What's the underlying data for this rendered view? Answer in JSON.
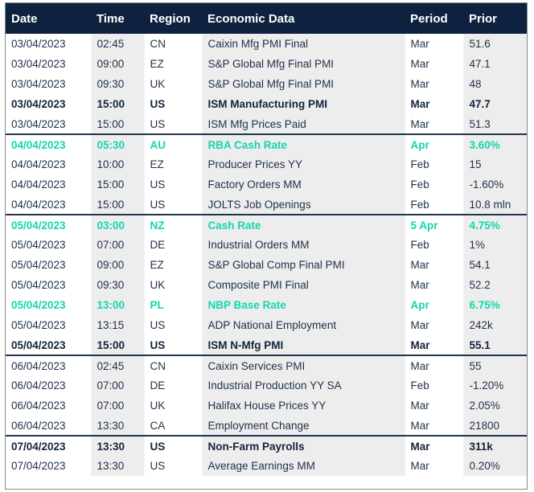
{
  "table": {
    "columns": [
      {
        "key": "date",
        "label": "Date"
      },
      {
        "key": "time",
        "label": "Time"
      },
      {
        "key": "region",
        "label": "Region"
      },
      {
        "key": "data",
        "label": "Economic Data"
      },
      {
        "key": "period",
        "label": "Period"
      },
      {
        "key": "prior",
        "label": "Prior"
      }
    ],
    "colors": {
      "header_bg": "#0e2240",
      "header_text": "#ffffff",
      "body_text": "#1f3048",
      "accent": "#13d6ae",
      "bold_text": "#12243c",
      "shade_bg": "#ededed",
      "row_bg": "#ffffff",
      "group_rule": "#20344d",
      "outer_border": "#8a8a8a"
    },
    "rows": [
      {
        "date": "03/04/2023",
        "time": "02:45",
        "region": "CN",
        "data": "Caixin Mfg PMI Final",
        "period": "Mar",
        "prior": "51.6",
        "style": "normal",
        "group_start": true
      },
      {
        "date": "03/04/2023",
        "time": "09:00",
        "region": "EZ",
        "data": "S&P Global Mfg Final PMI",
        "period": "Mar",
        "prior": "47.1",
        "style": "normal",
        "group_start": false
      },
      {
        "date": "03/04/2023",
        "time": "09:30",
        "region": "UK",
        "data": "S&P Global Mfg Final PMI",
        "period": "Mar",
        "prior": "48",
        "style": "normal",
        "group_start": false
      },
      {
        "date": "03/04/2023",
        "time": "15:00",
        "region": "US",
        "data": "ISM Manufacturing PMI",
        "period": "Mar",
        "prior": "47.7",
        "style": "bold",
        "group_start": false
      },
      {
        "date": "03/04/2023",
        "time": "15:00",
        "region": "US",
        "data": "ISM Mfg Prices Paid",
        "period": "Mar",
        "prior": "51.3",
        "style": "normal",
        "group_start": false
      },
      {
        "date": "04/04/2023",
        "time": "05:30",
        "region": "AU",
        "data": "RBA Cash Rate",
        "period": "Apr",
        "prior": "3.60%",
        "style": "accent",
        "group_start": true
      },
      {
        "date": "04/04/2023",
        "time": "10:00",
        "region": "EZ",
        "data": "Producer Prices YY",
        "period": "Feb",
        "prior": "15",
        "style": "normal",
        "group_start": false
      },
      {
        "date": "04/04/2023",
        "time": "15:00",
        "region": "US",
        "data": "Factory Orders MM",
        "period": "Feb",
        "prior": "-1.60%",
        "style": "normal",
        "group_start": false
      },
      {
        "date": "04/04/2023",
        "time": "15:00",
        "region": "US",
        "data": "JOLTS Job Openings",
        "period": "Feb",
        "prior": "10.8 mln",
        "style": "normal",
        "group_start": false
      },
      {
        "date": "05/04/2023",
        "time": "03:00",
        "region": "NZ",
        "data": "Cash Rate",
        "period": "5 Apr",
        "prior": "4.75%",
        "style": "accent",
        "group_start": true
      },
      {
        "date": "05/04/2023",
        "time": "07:00",
        "region": "DE",
        "data": "Industrial Orders MM",
        "period": "Feb",
        "prior": "1%",
        "style": "normal",
        "group_start": false
      },
      {
        "date": "05/04/2023",
        "time": "09:00",
        "region": "EZ",
        "data": "S&P Global Comp Final PMI",
        "period": "Mar",
        "prior": "54.1",
        "style": "normal",
        "group_start": false
      },
      {
        "date": "05/04/2023",
        "time": "09:30",
        "region": "UK",
        "data": "Composite PMI Final",
        "period": "Mar",
        "prior": "52.2",
        "style": "normal",
        "group_start": false
      },
      {
        "date": "05/04/2023",
        "time": "13:00",
        "region": "PL",
        "data": "NBP Base Rate",
        "period": "Apr",
        "prior": "6.75%",
        "style": "accent",
        "group_start": false
      },
      {
        "date": "05/04/2023",
        "time": "13:15",
        "region": "US",
        "data": "ADP National Employment",
        "period": "Mar",
        "prior": "242k",
        "style": "normal",
        "group_start": false
      },
      {
        "date": "05/04/2023",
        "time": "15:00",
        "region": "US",
        "data": "ISM N-Mfg PMI",
        "period": "Mar",
        "prior": "55.1",
        "style": "bold",
        "group_start": false
      },
      {
        "date": "06/04/2023",
        "time": "02:45",
        "region": "CN",
        "data": "Caixin Services PMI",
        "period": "Mar",
        "prior": "55",
        "style": "normal",
        "group_start": true
      },
      {
        "date": "06/04/2023",
        "time": "07:00",
        "region": "DE",
        "data": "Industrial Production YY SA",
        "period": "Feb",
        "prior": "-1.20%",
        "style": "normal",
        "group_start": false
      },
      {
        "date": "06/04/2023",
        "time": "07:00",
        "region": "UK",
        "data": "Halifax House Prices YY",
        "period": "Mar",
        "prior": "2.05%",
        "style": "normal",
        "group_start": false
      },
      {
        "date": "06/04/2023",
        "time": "13:30",
        "region": "CA",
        "data": "Employment Change",
        "period": "Mar",
        "prior": "21800",
        "style": "normal",
        "group_start": false
      },
      {
        "date": "07/04/2023",
        "time": "13:30",
        "region": "US",
        "data": "Non-Farm Payrolls",
        "period": "Mar",
        "prior": "311k",
        "style": "bold",
        "group_start": true
      },
      {
        "date": "07/04/2023",
        "time": "13:30",
        "region": "US",
        "data": "Average Earnings MM",
        "period": "Mar",
        "prior": "0.20%",
        "style": "normal",
        "group_start": false
      }
    ]
  }
}
